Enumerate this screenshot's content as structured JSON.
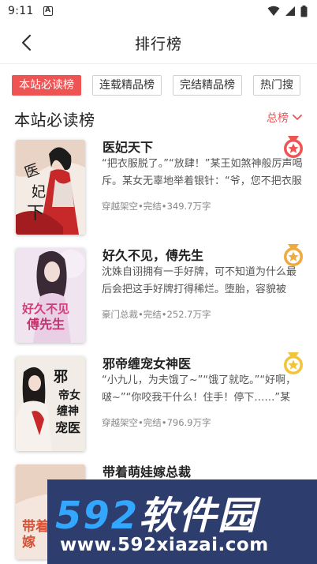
{
  "status": {
    "time": "9:11",
    "a_badge": "A"
  },
  "header": {
    "title": "排行榜"
  },
  "tabs": [
    {
      "label": "本站必读榜",
      "active": true
    },
    {
      "label": "连载精品榜",
      "active": false
    },
    {
      "label": "完结精品榜",
      "active": false
    },
    {
      "label": "热门搜",
      "active": false
    }
  ],
  "section": {
    "title": "本站必读榜",
    "filter_label": "总榜"
  },
  "books": [
    {
      "title": "医妃天下",
      "desc": "“把衣服脱了。”“放肆！”某王如煞神般厉声喝斥。某女无辜地举着银针：“爷，您不把衣服脱了，我怎么给您施针？”",
      "meta": "穿越架空•完结•349.7万字",
      "cover_text": "医妃天下",
      "rank_badge": "1"
    },
    {
      "title": "好久不见，傅先生",
      "desc": "沈姝自诩拥有一手好牌，可不知道为什么最后会把这手好牌打得稀烂。堕胎，容貌被毁……",
      "meta": "豪门总裁•完结•252.7万字",
      "cover_text": "好久不见傅先生",
      "rank_badge": "2"
    },
    {
      "title": "邪帝缠宠女神医",
      "desc": "“小九儿，为夫饿了~”“饿了就吃。”“好啊，啵~”“你咬我干什么！住手！停下……”某男……",
      "meta": "穿越架空•完结•796.9万字",
      "cover_text": "邪帝缠宠女神医",
      "rank_badge": "3"
    },
    {
      "title": "带着萌娃嫁总裁",
      "desc": "",
      "meta": "",
      "cover_text": "带着萌娃嫁",
      "rank_badge": ""
    }
  ],
  "watermark": {
    "big_text": "592软件园",
    "big_num": "592",
    "big_rest": "软件园",
    "url": "www.592xiazai.com"
  },
  "colors": {
    "accent": "#ef5455",
    "gold": "#f2a93b",
    "watermark_bg": "#2d3e6e"
  }
}
